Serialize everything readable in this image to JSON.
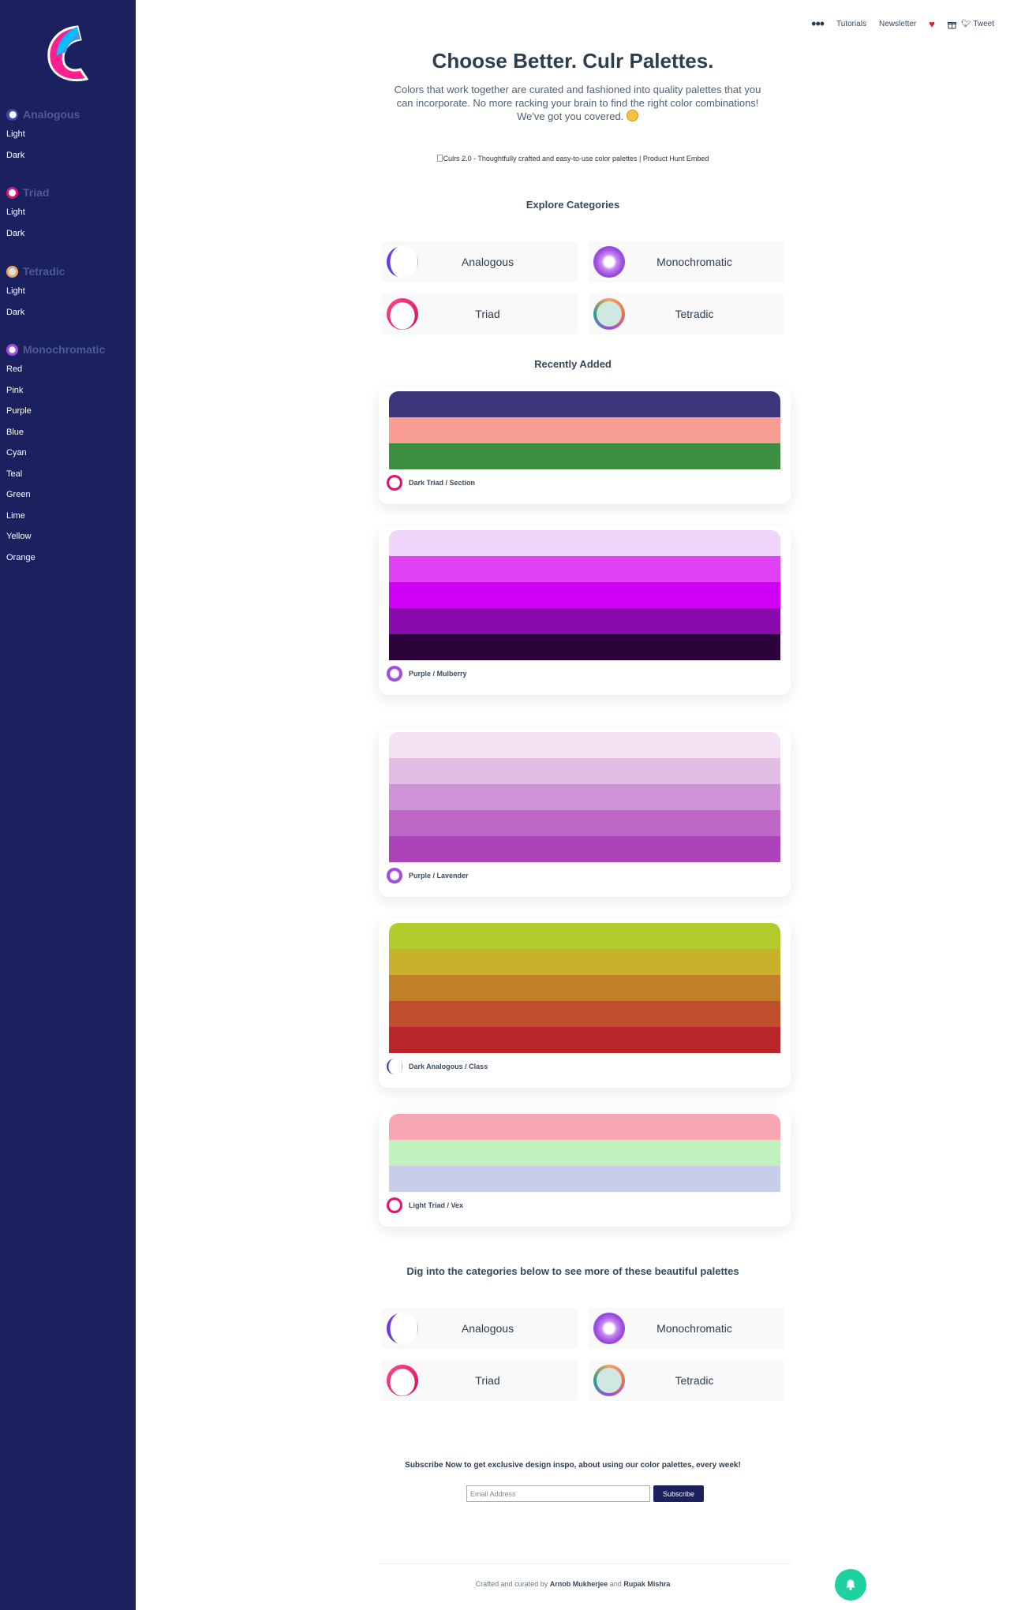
{
  "sidebar": {
    "sections": [
      {
        "label": "Analogous",
        "icon": "analogous-icon",
        "color": "#3b45b4",
        "items": [
          "Light",
          "Dark"
        ]
      },
      {
        "label": "Triad",
        "icon": "triad-icon",
        "color": "#e2136e",
        "items": [
          "Light",
          "Dark"
        ]
      },
      {
        "label": "Tetradic",
        "icon": "tetradic-icon",
        "color": "#f4a261",
        "items": [
          "Light",
          "Dark"
        ]
      },
      {
        "label": "Monochromatic",
        "icon": "monochromatic-icon",
        "color": "#9d4edd",
        "items": [
          "Red",
          "Pink",
          "Purple",
          "Blue",
          "Cyan",
          "Teal",
          "Green",
          "Lime",
          "Yellow",
          "Orange"
        ]
      }
    ]
  },
  "nav": {
    "menu_icon": "more-dots-icon",
    "tutorials": "Tutorials",
    "newsletter": "Newsletter",
    "tweet": "Tweet"
  },
  "hero": {
    "title": "Choose Better. Culr Palettes.",
    "subtitle": "Colors that work together are curated and fashioned into quality palettes that you can incorporate. No more racking your brain to find the right color combinations! We've got you covered."
  },
  "product_hunt_alt": "Culrs 2.0 - Thoughtfully crafted and easy-to-use color palettes | Product Hunt Embed",
  "explore_title": "Explore Categories",
  "categories": [
    {
      "label": "Analogous",
      "icon": "analogous-icon"
    },
    {
      "label": "Monochromatic",
      "icon": "monochromatic-icon"
    },
    {
      "label": "Triad",
      "icon": "triad-icon"
    },
    {
      "label": "Tetradic",
      "icon": "tetradic-icon"
    }
  ],
  "recent_title": "Recently Added",
  "palettes": [
    {
      "tag": "Dark Triad / Section",
      "tag_icon": "triad-icon",
      "colors": [
        "#3a3679",
        "#f79d94",
        "#3b8e3f"
      ]
    },
    {
      "tag": "Purple / Mulberry",
      "tag_icon": "monochromatic-icon",
      "colors": [
        "#f2d5fb",
        "#df42f4",
        "#d000f4",
        "#8a0bab",
        "#2d033c"
      ]
    },
    {
      "tag": "Purple / Lavender",
      "tag_icon": "monochromatic-icon",
      "colors": [
        "#f3e1f4",
        "#e2bde4",
        "#d194d8",
        "#bf67c6",
        "#ac44b9"
      ]
    },
    {
      "tag": "Dark Analogous / Class",
      "tag_icon": "analogous-icon",
      "colors": [
        "#b4cb2f",
        "#c8b22b",
        "#c27f2a",
        "#bf4e2c",
        "#b8252b"
      ]
    },
    {
      "tag": "Light Triad / Vex",
      "tag_icon": "triad-icon",
      "colors": [
        "#f8a6b1",
        "#c2f1c0",
        "#c8cde9"
      ]
    }
  ],
  "dig_title": "Dig into the categories below to see more of these beautiful palettes",
  "subscribe": {
    "title": "Subscribe Now to get exclusive design inspo, about using our color palettes, every week!",
    "placeholder": "Email Address",
    "button": "Subscribe"
  },
  "footer": {
    "prefix": "Crafted and curated by",
    "author1": "Arnob Mukherjee",
    "joiner": "and",
    "author2": "Rupak Mishra"
  },
  "colors": {
    "sidebar_bg": "#1b205e",
    "accent_green": "#1dd1a1"
  }
}
